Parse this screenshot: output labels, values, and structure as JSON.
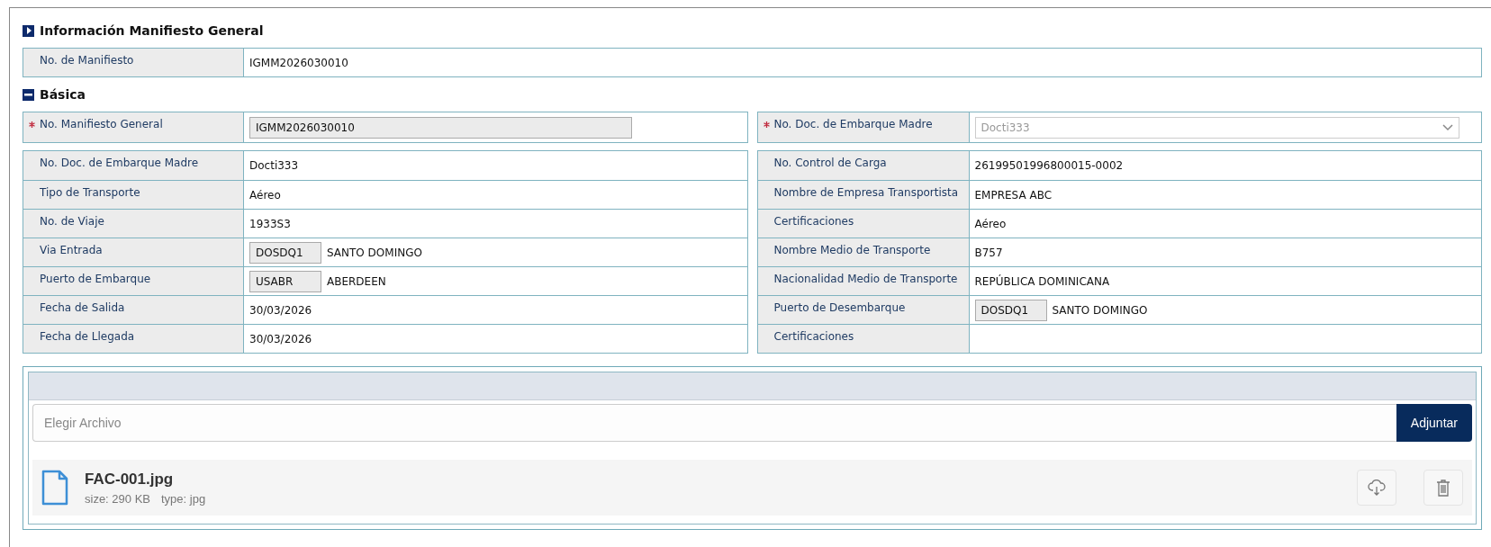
{
  "general": {
    "title": "Información Manifiesto General",
    "expanded": false,
    "field": {
      "label": "No. de Manifiesto",
      "value": "IGMM2026030010"
    }
  },
  "basica": {
    "title": "Básica",
    "expanded": true,
    "required": [
      {
        "label": "No. Manifiesto General",
        "kind": "readonly",
        "value": "IGMM2026030010",
        "required": true
      },
      {
        "label": "No. Doc. de Embarque Madre",
        "kind": "select",
        "value": "Docti333",
        "required": true,
        "disabled": true
      }
    ],
    "left": [
      {
        "label": "No. Doc. de Embarque Madre",
        "kind": "text",
        "value": "Docti333"
      },
      {
        "label": "Tipo de Transporte",
        "kind": "text",
        "value": "Aéreo"
      },
      {
        "label": "No. de Viaje",
        "kind": "text",
        "value": "1933S3"
      },
      {
        "label": "Via Entrada",
        "kind": "code",
        "code": "DOSDQ1",
        "value": "SANTO DOMINGO"
      },
      {
        "label": "Puerto de Embarque",
        "kind": "code",
        "code": "USABR",
        "value": "ABERDEEN"
      },
      {
        "label": "Fecha de Salida",
        "kind": "text",
        "value": "30/03/2026"
      },
      {
        "label": "Fecha de Llegada",
        "kind": "text",
        "value": "30/03/2026"
      }
    ],
    "right": [
      {
        "label": "No. Control de Carga",
        "kind": "text",
        "value": "26199501996800015-0002"
      },
      {
        "label": "Nombre de Empresa Transportista",
        "kind": "text",
        "value": "EMPRESA ABC"
      },
      {
        "label": "Certificaciones",
        "kind": "text",
        "value": "Aéreo"
      },
      {
        "label": "Nombre Medio de Transporte",
        "kind": "text",
        "value": "B757"
      },
      {
        "label": "Nacionalidad Medio de Transporte",
        "kind": "text",
        "value": "REPÚBLICA DOMINICANA"
      },
      {
        "label": "Puerto de Desembarque",
        "kind": "code",
        "code": "DOSDQ1",
        "value": "SANTO DOMINGO"
      },
      {
        "label": "Certificaciones",
        "kind": "empty"
      }
    ]
  },
  "upload": {
    "placeholder": "Elegir Archivo",
    "button": "Adjuntar",
    "files": [
      {
        "name": "FAC-001.jpg",
        "size": "size: 290 KB",
        "type": "type: jpg"
      }
    ]
  }
}
